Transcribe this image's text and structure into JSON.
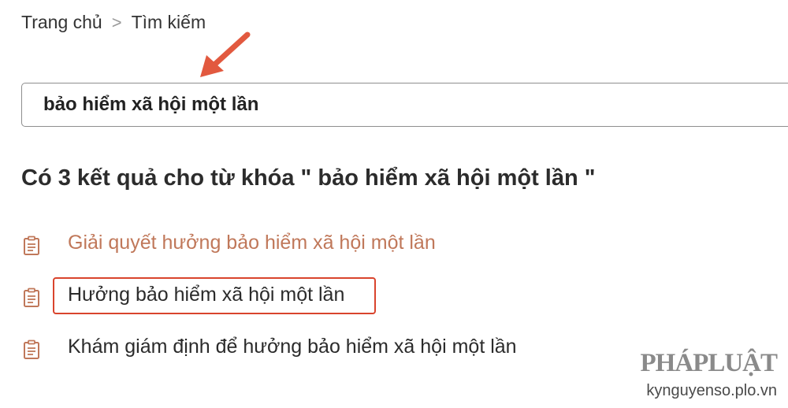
{
  "breadcrumb": {
    "home": "Trang chủ",
    "separator": ">",
    "current": "Tìm kiếm"
  },
  "search": {
    "value": "bảo hiểm xã hội một lần"
  },
  "results": {
    "heading": "Có 3 kết quả cho từ khóa \" bảo hiểm xã hội một lần \"",
    "items": [
      {
        "label": "Giải quyết hưởng bảo hiểm xã hội một lần",
        "visited": true
      },
      {
        "label": "Hưởng bảo hiểm xã hội một lần",
        "visited": false,
        "highlighted": true
      },
      {
        "label": "Khám giám định để hưởng bảo hiểm xã hội một lần",
        "visited": false
      }
    ]
  },
  "watermark": {
    "logo": "PHÁPLUẬT",
    "site": "kynguyenso.plo.vn"
  },
  "icons": {
    "result_icon": "document-icon",
    "annotation": "arrow-icon"
  },
  "colors": {
    "visited_link": "#c0785a",
    "annotation_red": "#d9442d",
    "icon_color": "#c0785a"
  }
}
